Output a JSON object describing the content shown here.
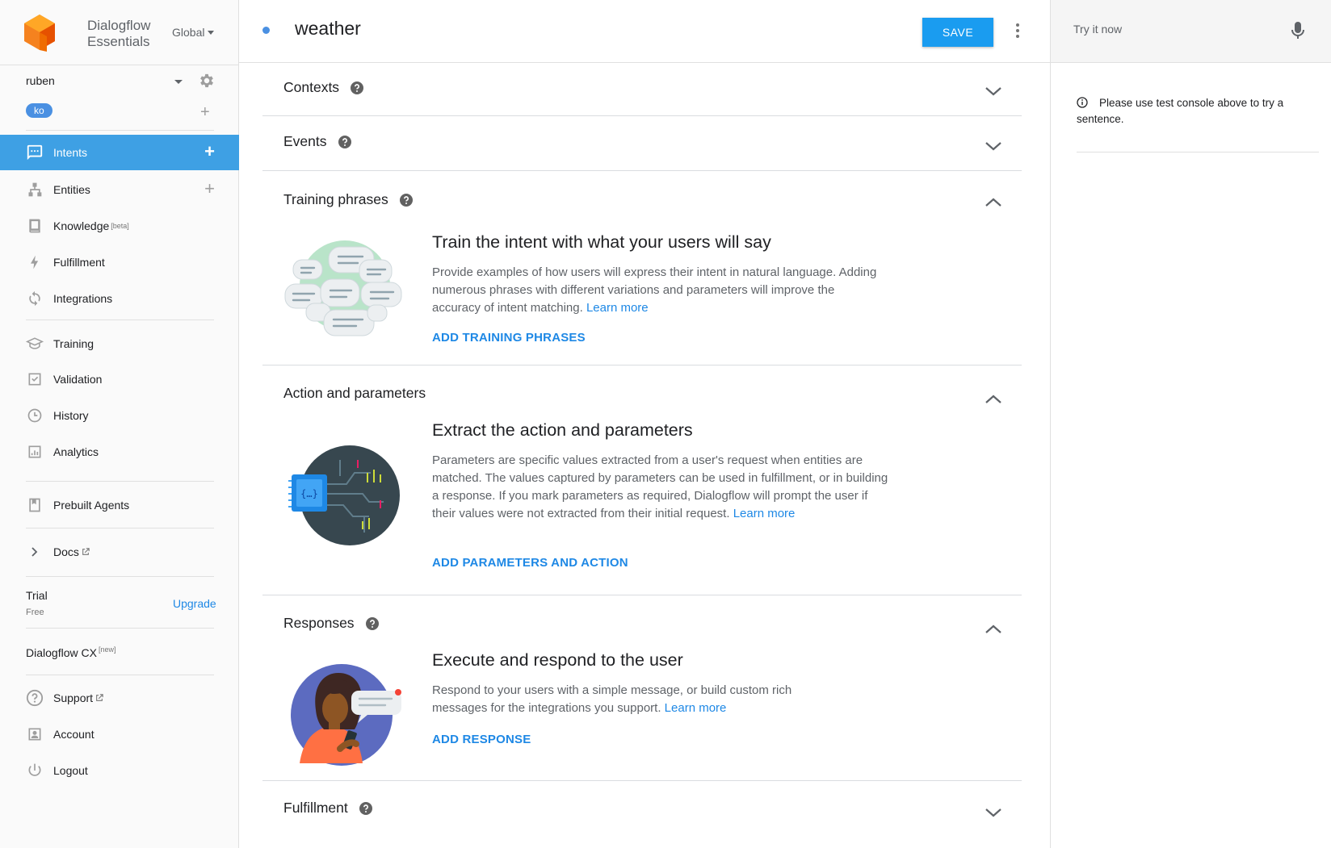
{
  "app": {
    "logo_line1": "Dialogflow",
    "logo_line2": "Essentials",
    "region": "Global"
  },
  "agent": {
    "name": "ruben",
    "language": "ko"
  },
  "nav": {
    "intents": "Intents",
    "entities": "Entities",
    "knowledge": "Knowledge",
    "knowledge_badge": "[beta]",
    "fulfillment": "Fulfillment",
    "integrations": "Integrations",
    "training": "Training",
    "validation": "Validation",
    "history": "History",
    "analytics": "Analytics",
    "prebuilt": "Prebuilt Agents",
    "docs": "Docs",
    "support": "Support",
    "account": "Account",
    "logout": "Logout"
  },
  "plan": {
    "name": "Trial",
    "tier": "Free",
    "upgrade": "Upgrade"
  },
  "cx": {
    "label": "Dialogflow CX",
    "badge": "[new]"
  },
  "header": {
    "intent_name": "weather",
    "save": "SAVE"
  },
  "test_console": {
    "placeholder": "Try it now",
    "info": "Please use test console above to try a sentence."
  },
  "sections": {
    "contexts": {
      "title": "Contexts"
    },
    "events": {
      "title": "Events"
    },
    "training": {
      "title": "Training phrases",
      "heading": "Train the intent with what your users will say",
      "desc": "Provide examples of how users will express their intent in natural language. Adding numerous phrases with different variations and parameters will improve the accuracy of intent matching.",
      "learn": "Learn more",
      "action": "ADD TRAINING PHRASES"
    },
    "actions": {
      "title": "Action and parameters",
      "heading": "Extract the action and parameters",
      "desc": "Parameters are specific values extracted from a user's request when entities are matched. The values captured by parameters can be used in fulfillment, or in building a response. If you mark parameters as required, Dialogflow will prompt the user if their values were not extracted from their initial request.",
      "learn": "Learn more",
      "action": "ADD PARAMETERS AND ACTION"
    },
    "responses": {
      "title": "Responses",
      "heading": "Execute and respond to the user",
      "desc": "Respond to your users with a simple message, or build custom rich messages for the integrations you support.",
      "learn": "Learn more",
      "action": "ADD RESPONSE"
    },
    "fulfillment": {
      "title": "Fulfillment"
    }
  },
  "colors": {
    "accent": "#3ea0e4",
    "link": "#1e88e5",
    "logo_orange": "#f5821f"
  }
}
